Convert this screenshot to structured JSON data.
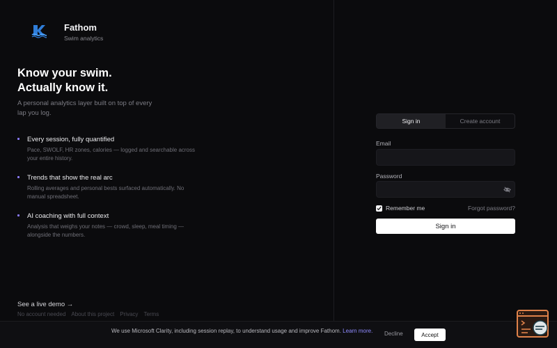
{
  "brand": {
    "name": "Fathom",
    "subtitle": "Swim analytics"
  },
  "hero": {
    "headline_line1": "Know your swim.",
    "headline_line2": "Actually know it.",
    "tagline": "A personal analytics layer built on top of every lap you log."
  },
  "features": [
    {
      "title": "Every session, fully quantified",
      "description": "Pace, SWOLF, HR zones, calories — logged and searchable across your entire history."
    },
    {
      "title": "Trends that show the real arc",
      "description": "Rolling averages and personal bests surfaced automatically. No manual spreadsheet."
    },
    {
      "title": "AI coaching with full context",
      "description": "Analysis that weighs your notes — crowd, sleep, meal timing — alongside the numbers."
    }
  ],
  "demo": {
    "link_label": "See a live demo →"
  },
  "footer": {
    "items": [
      "No account needed",
      "About this project",
      "Privacy",
      "Terms"
    ]
  },
  "auth": {
    "tabs": [
      {
        "label": "Sign in",
        "active": true
      },
      {
        "label": "Create account",
        "active": false
      }
    ],
    "email_label": "Email",
    "email_value": "",
    "password_label": "Password",
    "password_value": "",
    "remember_label": "Remember me",
    "remember_checked": true,
    "forgot_label": "Forgot password?",
    "submit_label": "Sign in"
  },
  "cookie": {
    "text": "We use Microsoft Clarity, including session replay, to understand usage and improve Fathom.",
    "link_label": "Learn more.",
    "decline_label": "Decline",
    "accept_label": "Accept"
  },
  "icons": {
    "logo": "swimmer-logo-icon",
    "bullet": "bullet-icon",
    "password_toggle": "eye-off-icon",
    "checkbox": "checkmark-icon",
    "widget": "feedback-widget-icon"
  },
  "colors": {
    "background": "#0b0b0d",
    "accent": "#8b7bff",
    "logo_blue": "#2f7dd8",
    "button_bg": "#ffffff",
    "widget_orange": "#e0824a"
  }
}
